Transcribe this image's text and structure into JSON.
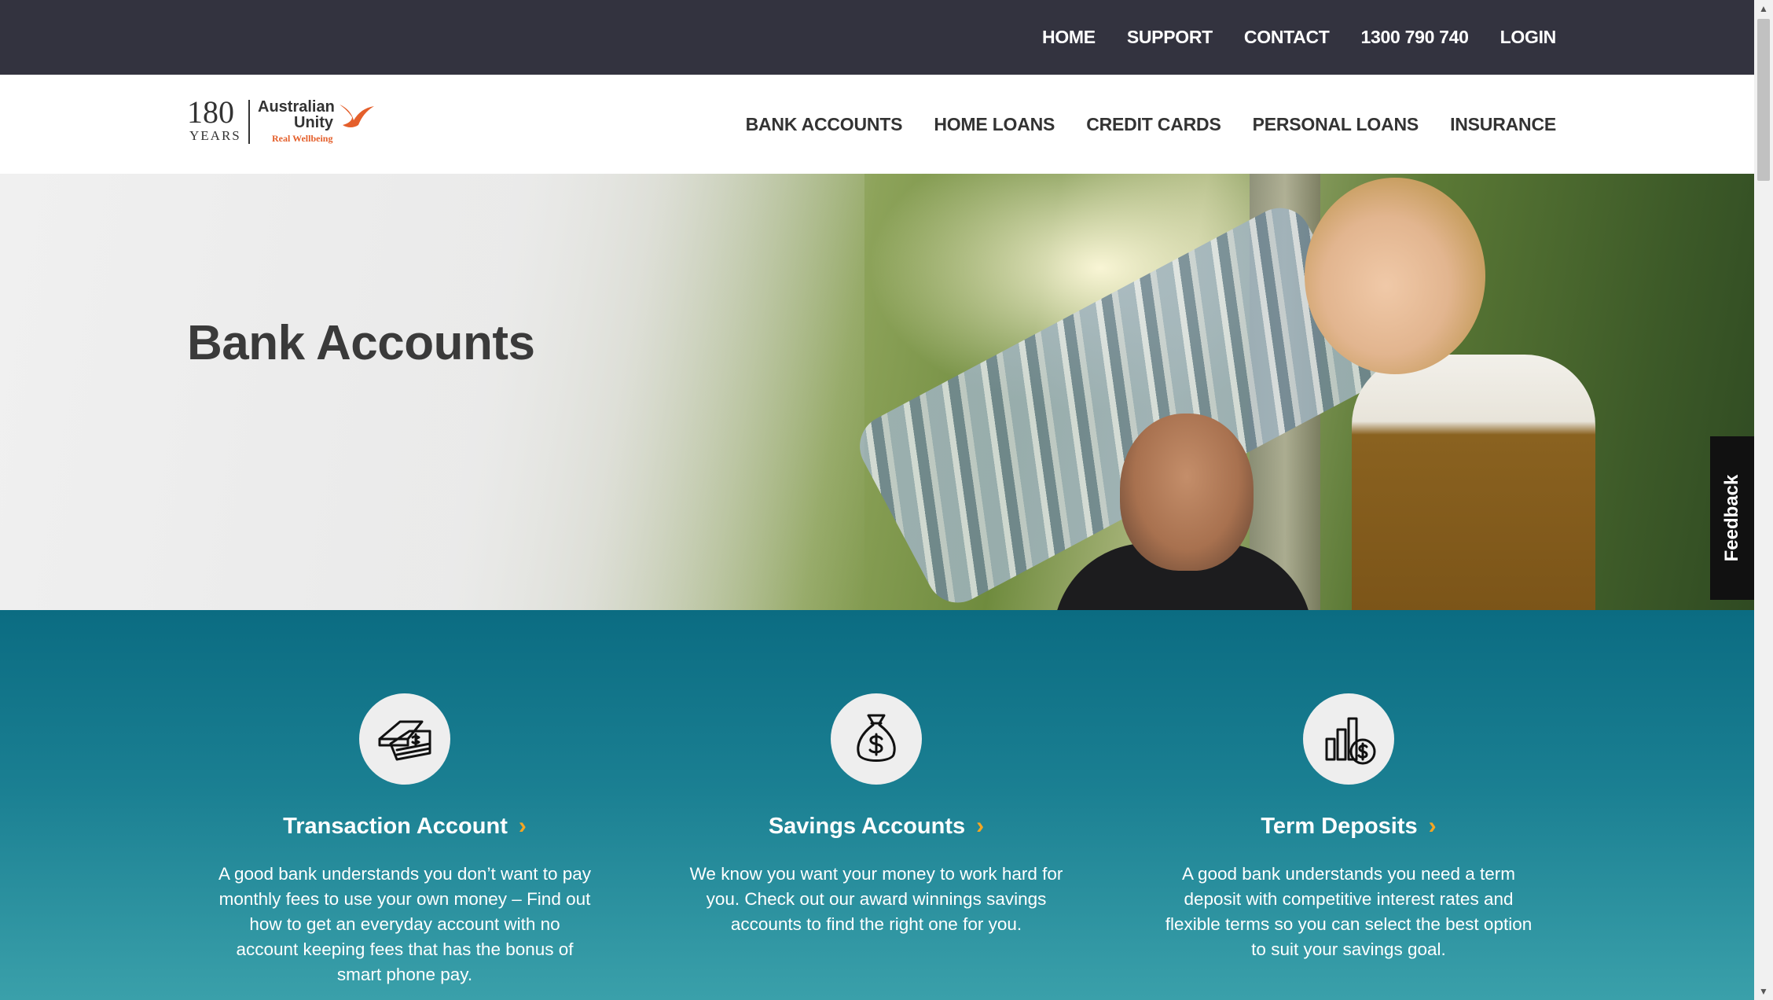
{
  "utility_nav": [
    {
      "label": "HOME"
    },
    {
      "label": "SUPPORT"
    },
    {
      "label": "CONTACT"
    },
    {
      "label": "1300 790 740"
    },
    {
      "label": "LOGIN"
    }
  ],
  "logo": {
    "years_number": "180",
    "years_word": "YEARS",
    "brand_line1": "Australian",
    "brand_line2": "Unity",
    "tagline": "Real Wellbeing"
  },
  "main_nav": [
    {
      "label": "BANK ACCOUNTS"
    },
    {
      "label": "HOME LOANS"
    },
    {
      "label": "CREDIT CARDS"
    },
    {
      "label": "PERSONAL LOANS"
    },
    {
      "label": "INSURANCE"
    }
  ],
  "hero": {
    "title": "Bank Accounts"
  },
  "feedback_label": "Feedback",
  "features": [
    {
      "icon": "cash-card-icon",
      "title": "Transaction Account",
      "description": "A good bank understands you don’t want to pay monthly fees to use your own money – Find out how to get an everyday account with no account keeping fees that has the bonus of smart phone pay."
    },
    {
      "icon": "money-bag-icon",
      "title": "Savings Accounts",
      "description": "We know you want your money to work hard for you. Check out our award winnings savings accounts to find the right one for you."
    },
    {
      "icon": "bar-chart-dollar-icon",
      "title": "Term Deposits",
      "description": "A good bank understands you need a term deposit with competitive interest rates and flexible terms so you can select the best option to suit your savings goal."
    }
  ],
  "colors": {
    "topbar": "#33333f",
    "teal": "#0b6c82",
    "accent_chevron": "#f5a623",
    "brand_orange": "#e45f2b"
  }
}
